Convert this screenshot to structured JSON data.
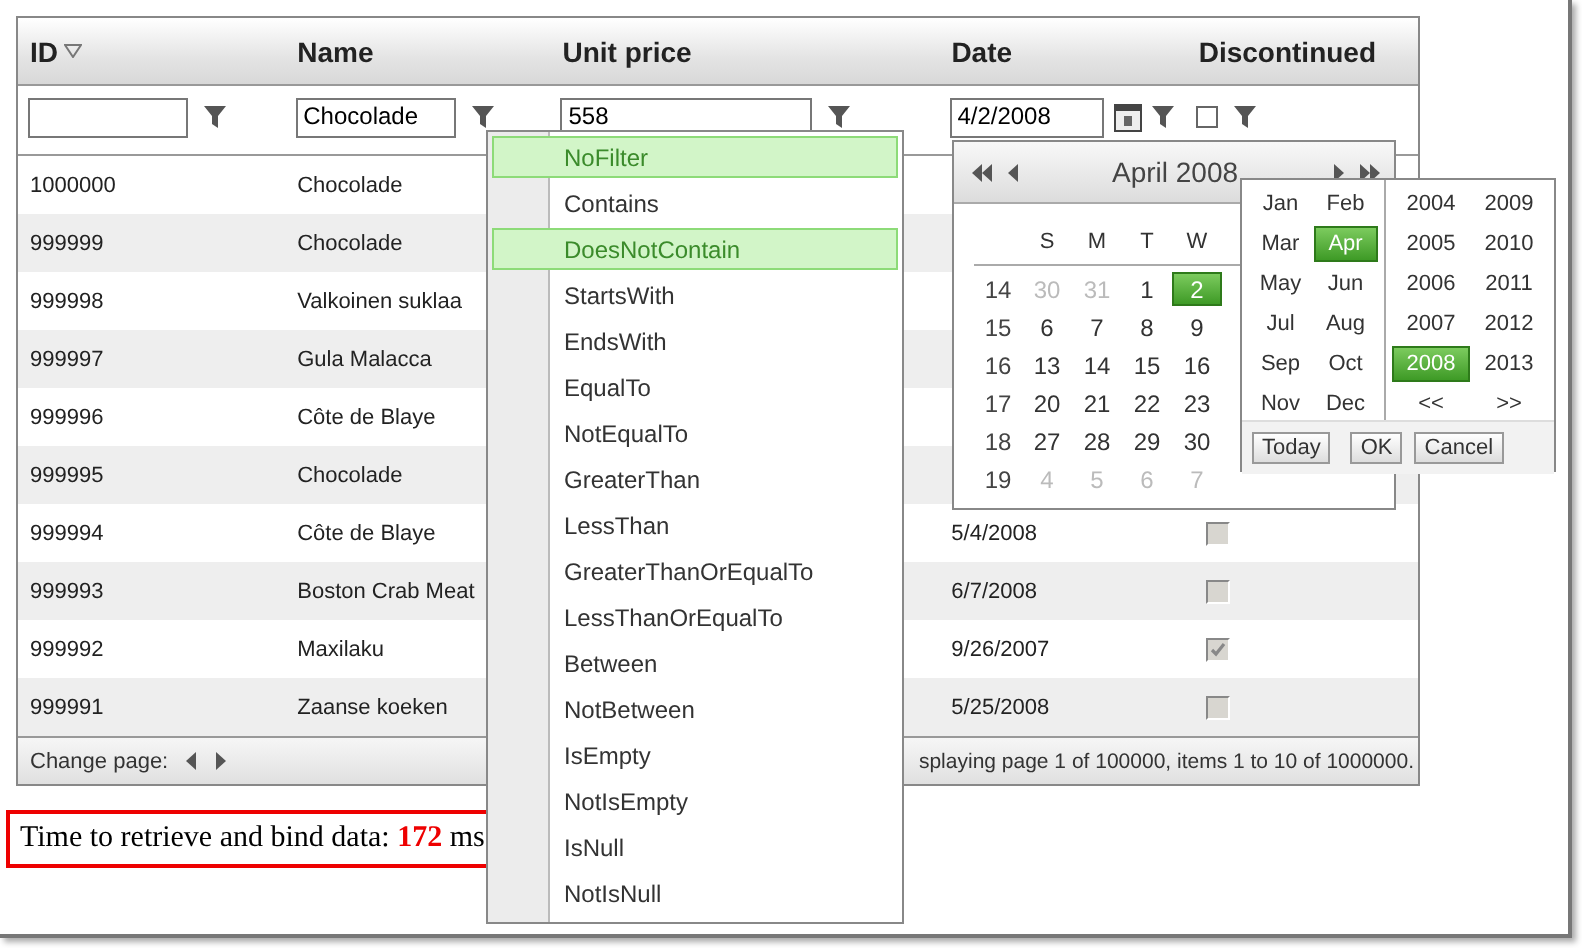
{
  "grid": {
    "columns": [
      {
        "label": "ID",
        "sorted": true
      },
      {
        "label": "Name",
        "sorted": false
      },
      {
        "label": "Unit price",
        "sorted": false
      },
      {
        "label": "Date",
        "sorted": false
      },
      {
        "label": "Discontinued",
        "sorted": false
      }
    ],
    "filters": [
      {
        "kind": "text"
      },
      {
        "kind": "text",
        "value": "Chocolade"
      },
      {
        "kind": "text",
        "value": "558"
      },
      {
        "kind": "date",
        "value": "4/2/2008"
      },
      {
        "kind": "checkbox",
        "checked": false
      }
    ],
    "rows": [
      {
        "id": "1000000",
        "name": "Chocolade"
      },
      {
        "id": "999999",
        "name": "Chocolade"
      },
      {
        "id": "999998",
        "name": "Valkoinen suklaa"
      },
      {
        "id": "999997",
        "name": "Gula Malacca"
      },
      {
        "id": "999996",
        "name": "Côte de Blaye"
      },
      {
        "id": "999995",
        "name": "Chocolade"
      },
      {
        "id": "999994",
        "name": "Côte de Blaye",
        "date": "5/4/2008",
        "discontinued": {
          "checked": false
        }
      },
      {
        "id": "999993",
        "name": "Boston Crab Meat",
        "date": "6/7/2008",
        "discontinued": {
          "checked": false
        }
      },
      {
        "id": "999992",
        "name": "Maxilaku",
        "date": "9/26/2007",
        "discontinued": {
          "checked": true
        }
      },
      {
        "id": "999991",
        "name": "Zaanse koeken",
        "date": "5/25/2008",
        "discontinued": {
          "checked": false
        }
      }
    ],
    "pager": {
      "label": "Change page:",
      "info": "splaying page 1 of 100000, items 1 to 10 of 1000000."
    }
  },
  "filter_menu": {
    "items": [
      {
        "label": "NoFilter",
        "selected": true
      },
      {
        "label": "Contains",
        "selected": false
      },
      {
        "label": "DoesNotContain",
        "selected": true
      },
      {
        "label": "StartsWith",
        "selected": false
      },
      {
        "label": "EndsWith",
        "selected": false
      },
      {
        "label": "EqualTo",
        "selected": false
      },
      {
        "label": "NotEqualTo",
        "selected": false
      },
      {
        "label": "GreaterThan",
        "selected": false
      },
      {
        "label": "LessThan",
        "selected": false
      },
      {
        "label": "GreaterThanOrEqualTo",
        "selected": false
      },
      {
        "label": "LessThanOrEqualTo",
        "selected": false
      },
      {
        "label": "Between",
        "selected": false
      },
      {
        "label": "NotBetween",
        "selected": false
      },
      {
        "label": "IsEmpty",
        "selected": false
      },
      {
        "label": "NotIsEmpty",
        "selected": false
      },
      {
        "label": "IsNull",
        "selected": false
      },
      {
        "label": "NotIsNull",
        "selected": false
      }
    ]
  },
  "calendar": {
    "title": "April 2008",
    "weekdays": [
      "S",
      "M",
      "T",
      "W"
    ],
    "weeks": [
      {
        "number": "14",
        "days": [
          {
            "label": "30",
            "other_month": true,
            "selected": false
          },
          {
            "label": "31",
            "other_month": true,
            "selected": false
          },
          {
            "label": "1",
            "other_month": false,
            "selected": false
          },
          {
            "label": "2",
            "other_month": false,
            "selected": true
          }
        ]
      },
      {
        "number": "15",
        "days": [
          {
            "label": "6",
            "other_month": false,
            "selected": false
          },
          {
            "label": "7",
            "other_month": false,
            "selected": false
          },
          {
            "label": "8",
            "other_month": false,
            "selected": false
          },
          {
            "label": "9",
            "other_month": false,
            "selected": false
          }
        ]
      },
      {
        "number": "16",
        "days": [
          {
            "label": "13",
            "other_month": false,
            "selected": false
          },
          {
            "label": "14",
            "other_month": false,
            "selected": false
          },
          {
            "label": "15",
            "other_month": false,
            "selected": false
          },
          {
            "label": "16",
            "other_month": false,
            "selected": false
          }
        ]
      },
      {
        "number": "17",
        "days": [
          {
            "label": "20",
            "other_month": false,
            "selected": false
          },
          {
            "label": "21",
            "other_month": false,
            "selected": false
          },
          {
            "label": "22",
            "other_month": false,
            "selected": false
          },
          {
            "label": "23",
            "other_month": false,
            "selected": false
          }
        ]
      },
      {
        "number": "18",
        "days": [
          {
            "label": "27",
            "other_month": false,
            "selected": false
          },
          {
            "label": "28",
            "other_month": false,
            "selected": false
          },
          {
            "label": "29",
            "other_month": false,
            "selected": false
          },
          {
            "label": "30",
            "other_month": false,
            "selected": false
          }
        ]
      },
      {
        "number": "19",
        "days": [
          {
            "label": "4",
            "other_month": true,
            "selected": false
          },
          {
            "label": "5",
            "other_month": true,
            "selected": false
          },
          {
            "label": "6",
            "other_month": true,
            "selected": false
          },
          {
            "label": "7",
            "other_month": true,
            "selected": false
          }
        ]
      }
    ]
  },
  "month_picker": {
    "months": [
      {
        "label": "Jan",
        "selected": false
      },
      {
        "label": "Feb",
        "selected": false
      },
      {
        "label": "Mar",
        "selected": false
      },
      {
        "label": "Apr",
        "selected": true
      },
      {
        "label": "May",
        "selected": false
      },
      {
        "label": "Jun",
        "selected": false
      },
      {
        "label": "Jul",
        "selected": false
      },
      {
        "label": "Aug",
        "selected": false
      },
      {
        "label": "Sep",
        "selected": false
      },
      {
        "label": "Oct",
        "selected": false
      },
      {
        "label": "Nov",
        "selected": false
      },
      {
        "label": "Dec",
        "selected": false
      }
    ],
    "years": [
      {
        "label": "2004",
        "selected": false
      },
      {
        "label": "2009",
        "selected": false
      },
      {
        "label": "2005",
        "selected": false
      },
      {
        "label": "2010",
        "selected": false
      },
      {
        "label": "2006",
        "selected": false
      },
      {
        "label": "2011",
        "selected": false
      },
      {
        "label": "2007",
        "selected": false
      },
      {
        "label": "2012",
        "selected": false
      },
      {
        "label": "2008",
        "selected": true
      },
      {
        "label": "2013",
        "selected": false
      }
    ],
    "year_nav": [
      "<<",
      ">>"
    ],
    "buttons": [
      "Today",
      "OK",
      "Cancel"
    ]
  },
  "timing": {
    "text": "Time to retrieve and bind data: **172** ms"
  }
}
